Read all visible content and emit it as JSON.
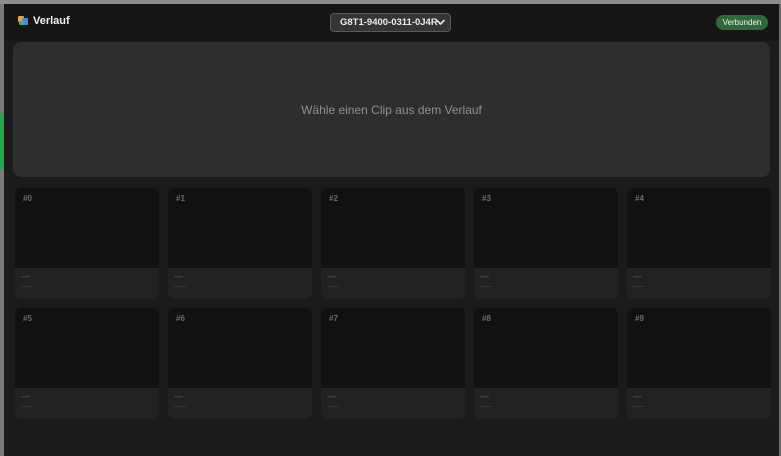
{
  "header": {
    "title": "Verlauf",
    "device_select": {
      "value": "G8T1-9400-0311-0J4R"
    },
    "status": "Verbunden"
  },
  "preview": {
    "hint": "Wähle einen Clip aus dem Verlauf"
  },
  "clips": [
    {
      "index": "#0",
      "title": "—",
      "meta": "——"
    },
    {
      "index": "#1",
      "title": "—",
      "meta": "——"
    },
    {
      "index": "#2",
      "title": "—",
      "meta": "——"
    },
    {
      "index": "#3",
      "title": "—",
      "meta": "——"
    },
    {
      "index": "#4",
      "title": "—",
      "meta": "——"
    },
    {
      "index": "#5",
      "title": "—",
      "meta": "——"
    },
    {
      "index": "#6",
      "title": "—",
      "meta": "——"
    },
    {
      "index": "#7",
      "title": "—",
      "meta": "——"
    },
    {
      "index": "#8",
      "title": "—",
      "meta": "——"
    },
    {
      "index": "#9",
      "title": "—",
      "meta": "——"
    }
  ]
}
